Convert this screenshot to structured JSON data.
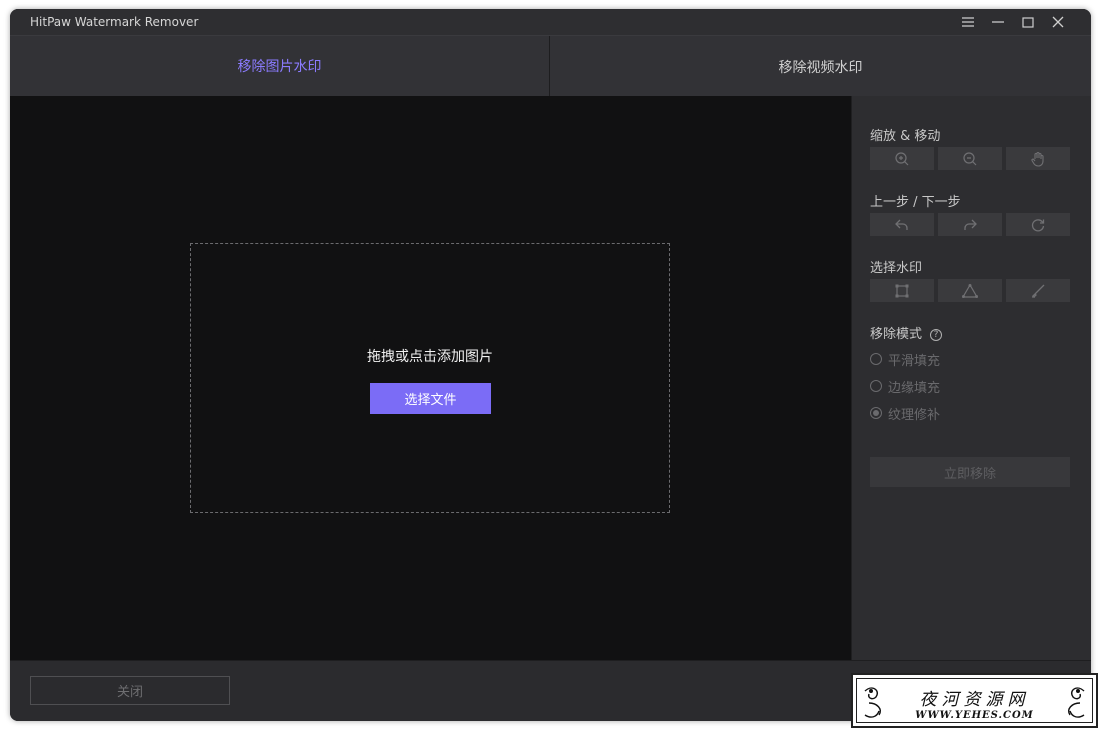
{
  "app": {
    "title": "HitPaw Watermark Remover"
  },
  "window_controls": {
    "menu_icon": "menu-icon",
    "minimize_icon": "minimize-icon",
    "maximize_icon": "maximize-icon",
    "close_icon": "close-icon"
  },
  "tabs": [
    {
      "label": "移除图片水印",
      "active": true
    },
    {
      "label": "移除视频水印",
      "active": false
    }
  ],
  "dropzone": {
    "prompt": "拖拽或点击添加图片",
    "button_label": "选择文件"
  },
  "panel": {
    "zoom_move_label": "缩放 & 移动",
    "zoom_tools": [
      "zoom-in-icon",
      "zoom-out-icon",
      "hand-icon"
    ],
    "undo_redo_label": "上一步 / 下一步",
    "history_tools": [
      "undo-icon",
      "redo-icon",
      "reset-icon"
    ],
    "select_watermark_label": "选择水印",
    "select_tools": [
      "rect-select-icon",
      "polygon-select-icon",
      "brush-icon"
    ],
    "remove_mode_label": "移除模式",
    "remove_modes": [
      {
        "label": "平滑填充",
        "checked": false
      },
      {
        "label": "边缘填充",
        "checked": false
      },
      {
        "label": "纹理修补",
        "checked": true
      }
    ],
    "remove_now_label": "立即移除"
  },
  "bottom": {
    "close_label": "关闭"
  },
  "watermark_badge": {
    "title": "夜河资源网",
    "url": "WWW.YEHES.COM"
  },
  "colors": {
    "accent": "#7b6cf6",
    "active_tab_text": "#8b7bff",
    "canvas_bg": "#111112",
    "panel_bg": "#2d2d30"
  }
}
